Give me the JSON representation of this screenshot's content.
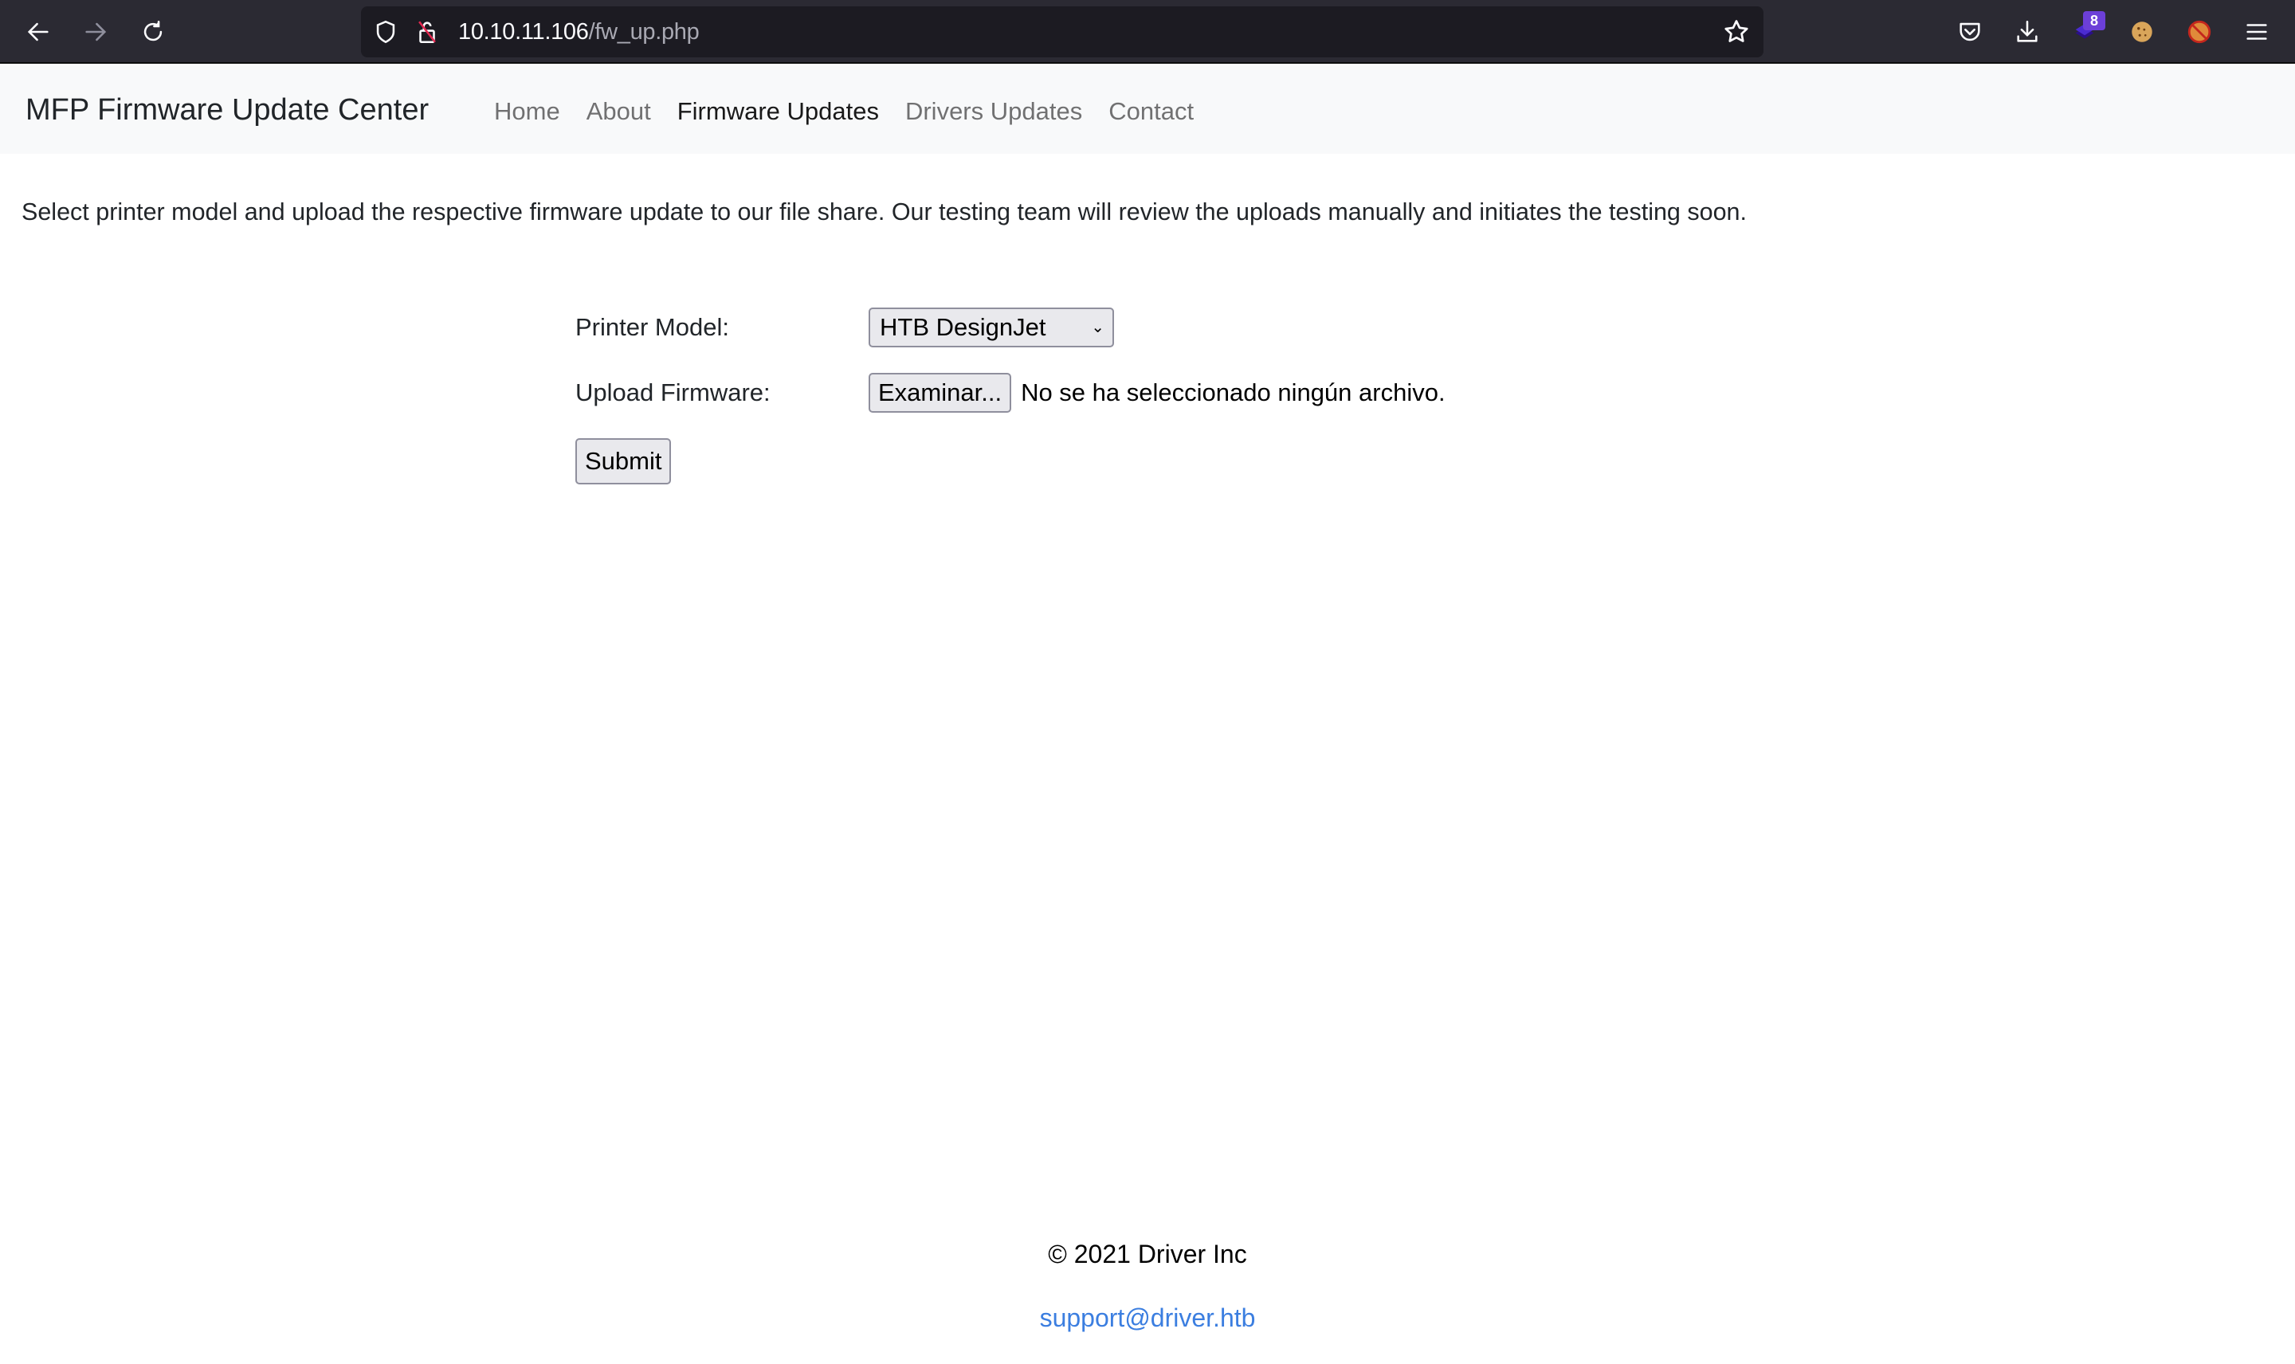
{
  "browser": {
    "url_host": "10.10.11.106",
    "url_path": "/fw_up.php",
    "extension_badge_count": "8",
    "icons": [
      "back-arrow-icon",
      "forward-arrow-icon",
      "reload-icon",
      "shield-icon",
      "insecure-lock-icon",
      "bookmark-star-icon",
      "pocket-icon",
      "download-icon",
      "extension-stack-icon",
      "cookie-icon",
      "blocked-fox-icon",
      "menu-hamburger-icon"
    ]
  },
  "navbar": {
    "brand": "MFP Firmware Update Center",
    "items": [
      {
        "label": "Home",
        "active": false
      },
      {
        "label": "About",
        "active": false
      },
      {
        "label": "Firmware Updates",
        "active": true
      },
      {
        "label": "Drivers Updates",
        "active": false
      },
      {
        "label": "Contact",
        "active": false
      }
    ]
  },
  "main": {
    "intro": "Select printer model and upload the respective firmware update to our file share. Our testing team will review the uploads manually and initiates the testing soon.",
    "form": {
      "printer_model_label": "Printer Model:",
      "printer_model_value": "HTB DesignJet",
      "upload_label": "Upload Firmware:",
      "browse_button": "Examinar...",
      "file_status": "No se ha seleccionado ningún archivo.",
      "submit_label": "Submit"
    }
  },
  "footer": {
    "copyright": "© 2021 Driver Inc",
    "email": "support@driver.htb"
  },
  "colors": {
    "toolbar_bg": "#2b2a33",
    "urlbar_bg": "#1c1b22",
    "navbar_bg": "#f8f9fa",
    "link": "#3b7ee0",
    "badge": "#6c3fd8"
  }
}
